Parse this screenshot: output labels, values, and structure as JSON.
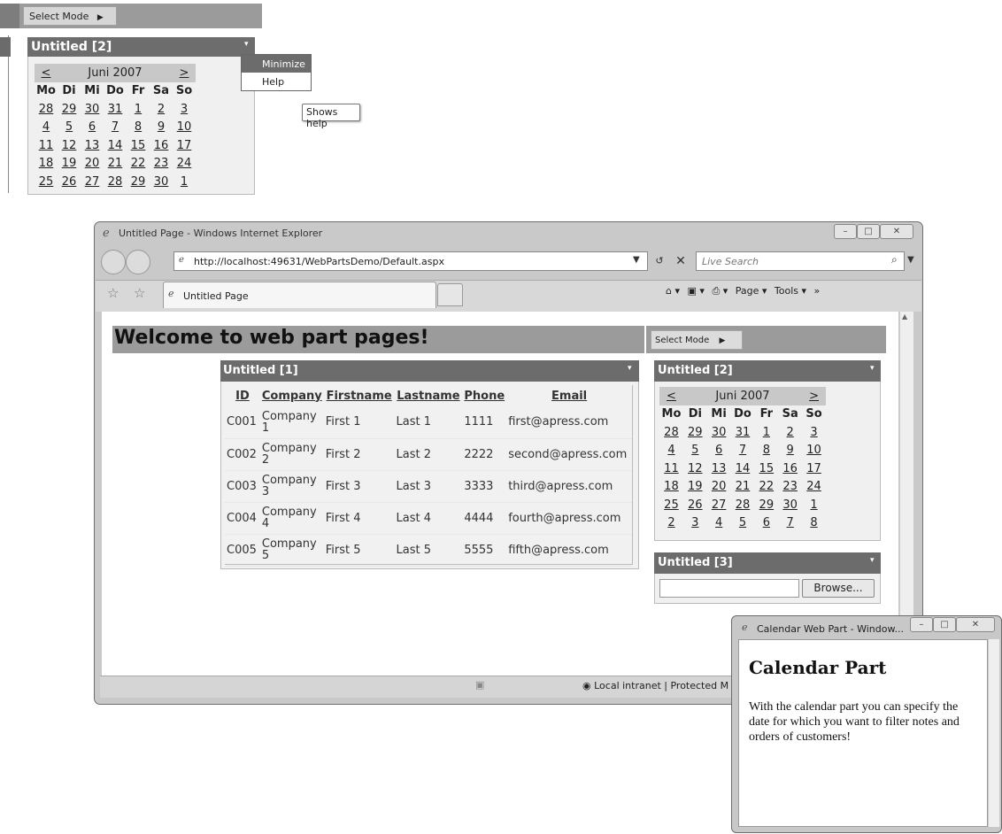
{
  "inset": {
    "mode_label": "Select Mode",
    "mode_arrow": "▶",
    "webpart_title": "Untitled [2]",
    "verbs_glyph": "▾",
    "menu": {
      "minimize": "Minimize",
      "help": "Help"
    },
    "tooltip": "Shows help",
    "calendar": {
      "prev": "<",
      "month": "Juni 2007",
      "next": ">",
      "days": [
        "Mo",
        "Di",
        "Mi",
        "Do",
        "Fr",
        "Sa",
        "So"
      ],
      "weeks": [
        [
          "28",
          "29",
          "30",
          "31",
          "1",
          "2",
          "3"
        ],
        [
          "4",
          "5",
          "6",
          "7",
          "8",
          "9",
          "10"
        ],
        [
          "11",
          "12",
          "13",
          "14",
          "15",
          "16",
          "17"
        ],
        [
          "18",
          "19",
          "20",
          "21",
          "22",
          "23",
          "24"
        ],
        [
          "25",
          "26",
          "27",
          "28",
          "29",
          "30",
          "1"
        ]
      ]
    }
  },
  "ie": {
    "window_title": "Untitled Page - Windows Internet Explorer",
    "window_buttons": {
      "minimize": "–",
      "maximize": "□",
      "close": "✕"
    },
    "address": "http://localhost:49631/WebPartsDemo/Default.aspx",
    "search_placeholder": "Live Search",
    "refresh_glyph": "↺",
    "stop_glyph": "✕",
    "search_glyph": "⌕",
    "tab_title": "Untitled Page",
    "commands": {
      "home": "⌂ ▾",
      "feeds": "▣ ▾",
      "print": "⎙ ▾",
      "page": "Page ▾",
      "tools": "Tools ▾",
      "more": "»"
    },
    "status": "Local intranet | Protected M"
  },
  "page": {
    "welcome": "Welcome to web part pages!",
    "mode_label": "Select Mode",
    "mode_arrow": "▶",
    "wp1_title": "Untitled [1]",
    "wp2_title": "Untitled [2]",
    "wp3_title": "Untitled [3]",
    "verbs_glyph": "▾",
    "browse_label": "Browse...",
    "grid": {
      "headers": [
        "ID",
        "Company",
        "Firstname",
        "Lastname",
        "Phone",
        "Email"
      ],
      "rows": [
        {
          "id": "C001",
          "company": "Company",
          "company_num": "1",
          "first": "First 1",
          "last": "Last 1",
          "phone": "1111",
          "email": "first@apress.com"
        },
        {
          "id": "C002",
          "company": "Company",
          "company_num": "2",
          "first": "First 2",
          "last": "Last 2",
          "phone": "2222",
          "email": "second@apress.com"
        },
        {
          "id": "C003",
          "company": "Company",
          "company_num": "3",
          "first": "First 3",
          "last": "Last 3",
          "phone": "3333",
          "email": "third@apress.com"
        },
        {
          "id": "C004",
          "company": "Company",
          "company_num": "4",
          "first": "First 4",
          "last": "Last 4",
          "phone": "4444",
          "email": "fourth@apress.com"
        },
        {
          "id": "C005",
          "company": "Company",
          "company_num": "5",
          "first": "First 5",
          "last": "Last 5",
          "phone": "5555",
          "email": "fifth@apress.com"
        }
      ]
    },
    "calendar": {
      "prev": "<",
      "month": "Juni 2007",
      "next": ">",
      "days": [
        "Mo",
        "Di",
        "Mi",
        "Do",
        "Fr",
        "Sa",
        "So"
      ],
      "weeks": [
        [
          "28",
          "29",
          "30",
          "31",
          "1",
          "2",
          "3"
        ],
        [
          "4",
          "5",
          "6",
          "7",
          "8",
          "9",
          "10"
        ],
        [
          "11",
          "12",
          "13",
          "14",
          "15",
          "16",
          "17"
        ],
        [
          "18",
          "19",
          "20",
          "21",
          "22",
          "23",
          "24"
        ],
        [
          "25",
          "26",
          "27",
          "28",
          "29",
          "30",
          "1"
        ],
        [
          "2",
          "3",
          "4",
          "5",
          "6",
          "7",
          "8"
        ]
      ]
    }
  },
  "popup": {
    "window_title": "Calendar Web Part - Window...",
    "heading": "Calendar Part",
    "body": "With the calendar part you can specify the date for which you want to filter notes and orders of customers!"
  }
}
